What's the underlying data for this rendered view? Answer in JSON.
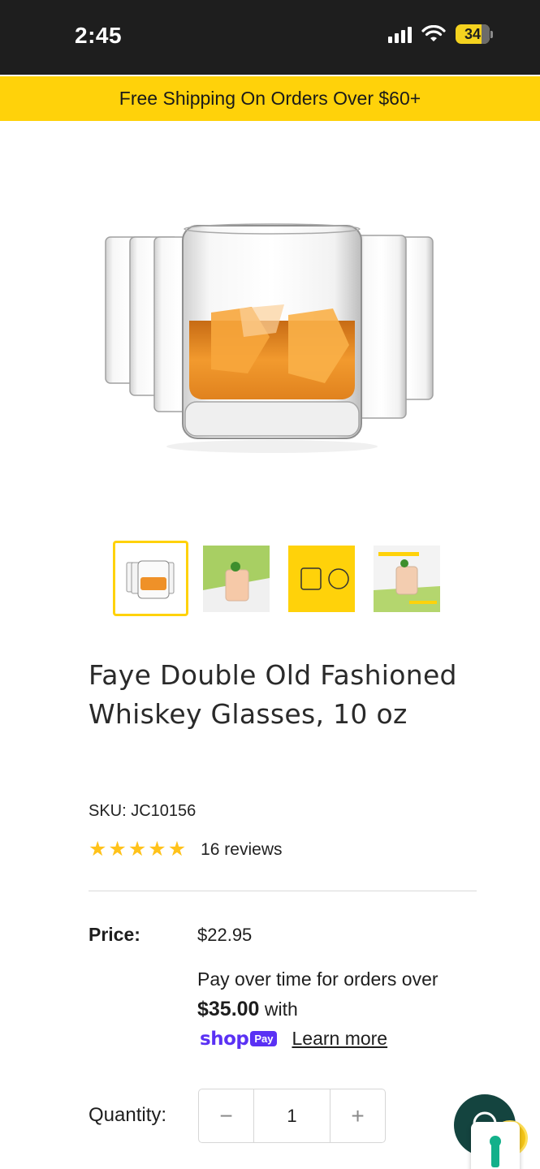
{
  "status_bar": {
    "time": "2:45",
    "battery_level": "34",
    "battery_color": "#f4d21f",
    "background": "#1e1e1e"
  },
  "promo_banner": {
    "text": "Free Shipping On Orders Over $60+",
    "background": "#ffd20a"
  },
  "product": {
    "title": "Faye Double Old Fashioned Whiskey Glasses, 10 oz",
    "sku": "SKU: JC10156",
    "rating": 5,
    "rating_max": 5,
    "reviews_text": "16 reviews",
    "price_label": "Price:",
    "price": "$22.95",
    "thumbnails": [
      {
        "name": "glasses-set-thumb",
        "selected": true
      },
      {
        "name": "cocktail-green-thumb",
        "selected": false
      },
      {
        "name": "dimensions-yellow-thumb",
        "selected": false
      },
      {
        "name": "infographic-thumb",
        "selected": false
      }
    ]
  },
  "installment": {
    "line_prefix": "Pay over time for orders over ",
    "amount": "$35.00",
    "line_suffix": " with",
    "shop_word": "shop",
    "pay_badge": "Pay",
    "learn_more": "Learn more",
    "brand_color": "#5a31f4"
  },
  "quantity": {
    "label": "Quantity:",
    "value": "1",
    "minus": "−",
    "plus": "+"
  },
  "colors": {
    "accent_yellow": "#ffd20a",
    "star": "#ffc21a",
    "chat_fab": "#14443f"
  },
  "icons": [
    "signal-icon",
    "wifi-icon",
    "battery-icon",
    "star-icon",
    "chat-icon",
    "lock-icon"
  ]
}
